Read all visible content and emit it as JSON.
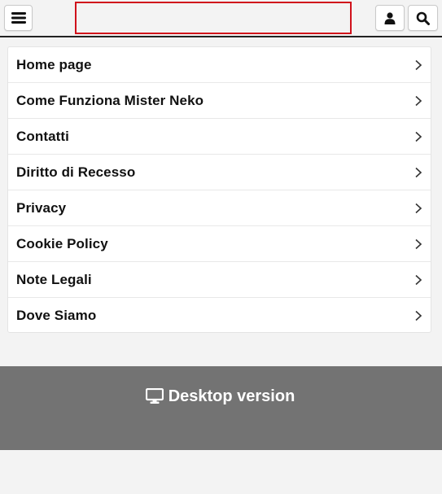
{
  "header": {
    "menu_icon": "hamburger-menu-icon",
    "user_icon": "user-icon",
    "search_icon": "search-icon",
    "logo_highlight_color": "#d0111b"
  },
  "menu": {
    "items": [
      {
        "label": "Home page"
      },
      {
        "label": "Come Funziona Mister Neko"
      },
      {
        "label": "Contatti"
      },
      {
        "label": "Diritto di Recesso"
      },
      {
        "label": "Privacy"
      },
      {
        "label": "Cookie Policy"
      },
      {
        "label": "Note Legali"
      },
      {
        "label": "Dove Siamo"
      }
    ],
    "chevron_icon": "chevron-right-icon"
  },
  "footer": {
    "desktop_label": "Desktop version",
    "desktop_icon": "monitor-icon",
    "band_color": "#737373"
  }
}
